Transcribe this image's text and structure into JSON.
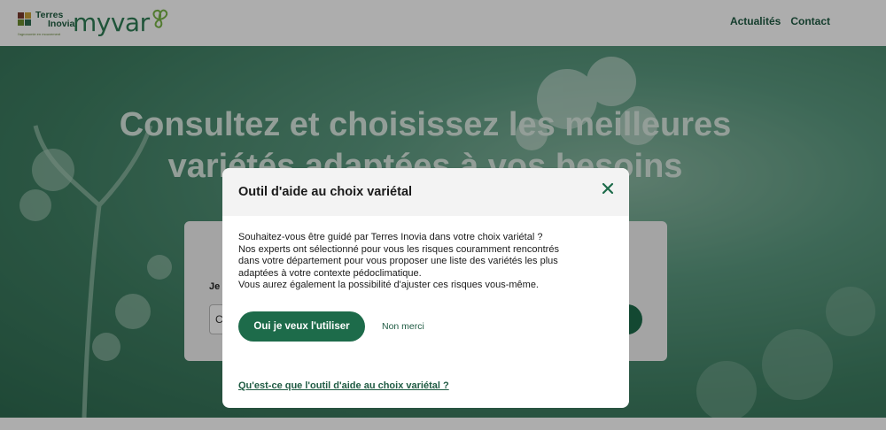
{
  "header": {
    "brand_name_line1": "Terres",
    "brand_name_line2": "Inovia",
    "brand_tagline": "l'agronomie en mouvement",
    "app_name": "myvar",
    "nav": [
      {
        "label": "Actualités"
      },
      {
        "label": "Contact"
      }
    ]
  },
  "hero": {
    "title_line1": "Consultez et choisissez les meilleures",
    "title_line2": "variétés adaptées à vos besoins",
    "search_label_partial": "Je",
    "search_input_partial": "C"
  },
  "modal": {
    "title": "Outil d'aide au choix variétal",
    "body_lines": [
      "Souhaitez-vous être guidé par Terres Inovia dans votre choix variétal ?",
      "Nos experts ont sélectionné pour vous les risques couramment rencontrés",
      "dans votre département pour vous proposer une liste des variétés les plus",
      "adaptées à votre contexte pédoclimatique.",
      "Vous aurez également la possibilité d'ajuster ces risques vous-même."
    ],
    "yes_button": "Oui je veux l'utiliser",
    "no_link": "Non merci",
    "info_link": "Qu'est-ce que l'outil d'aide au choix variétal ?"
  },
  "colors": {
    "brand_green": "#1d6b4a",
    "link_green": "#1f5b43",
    "hero_green": "#3f7f63"
  }
}
